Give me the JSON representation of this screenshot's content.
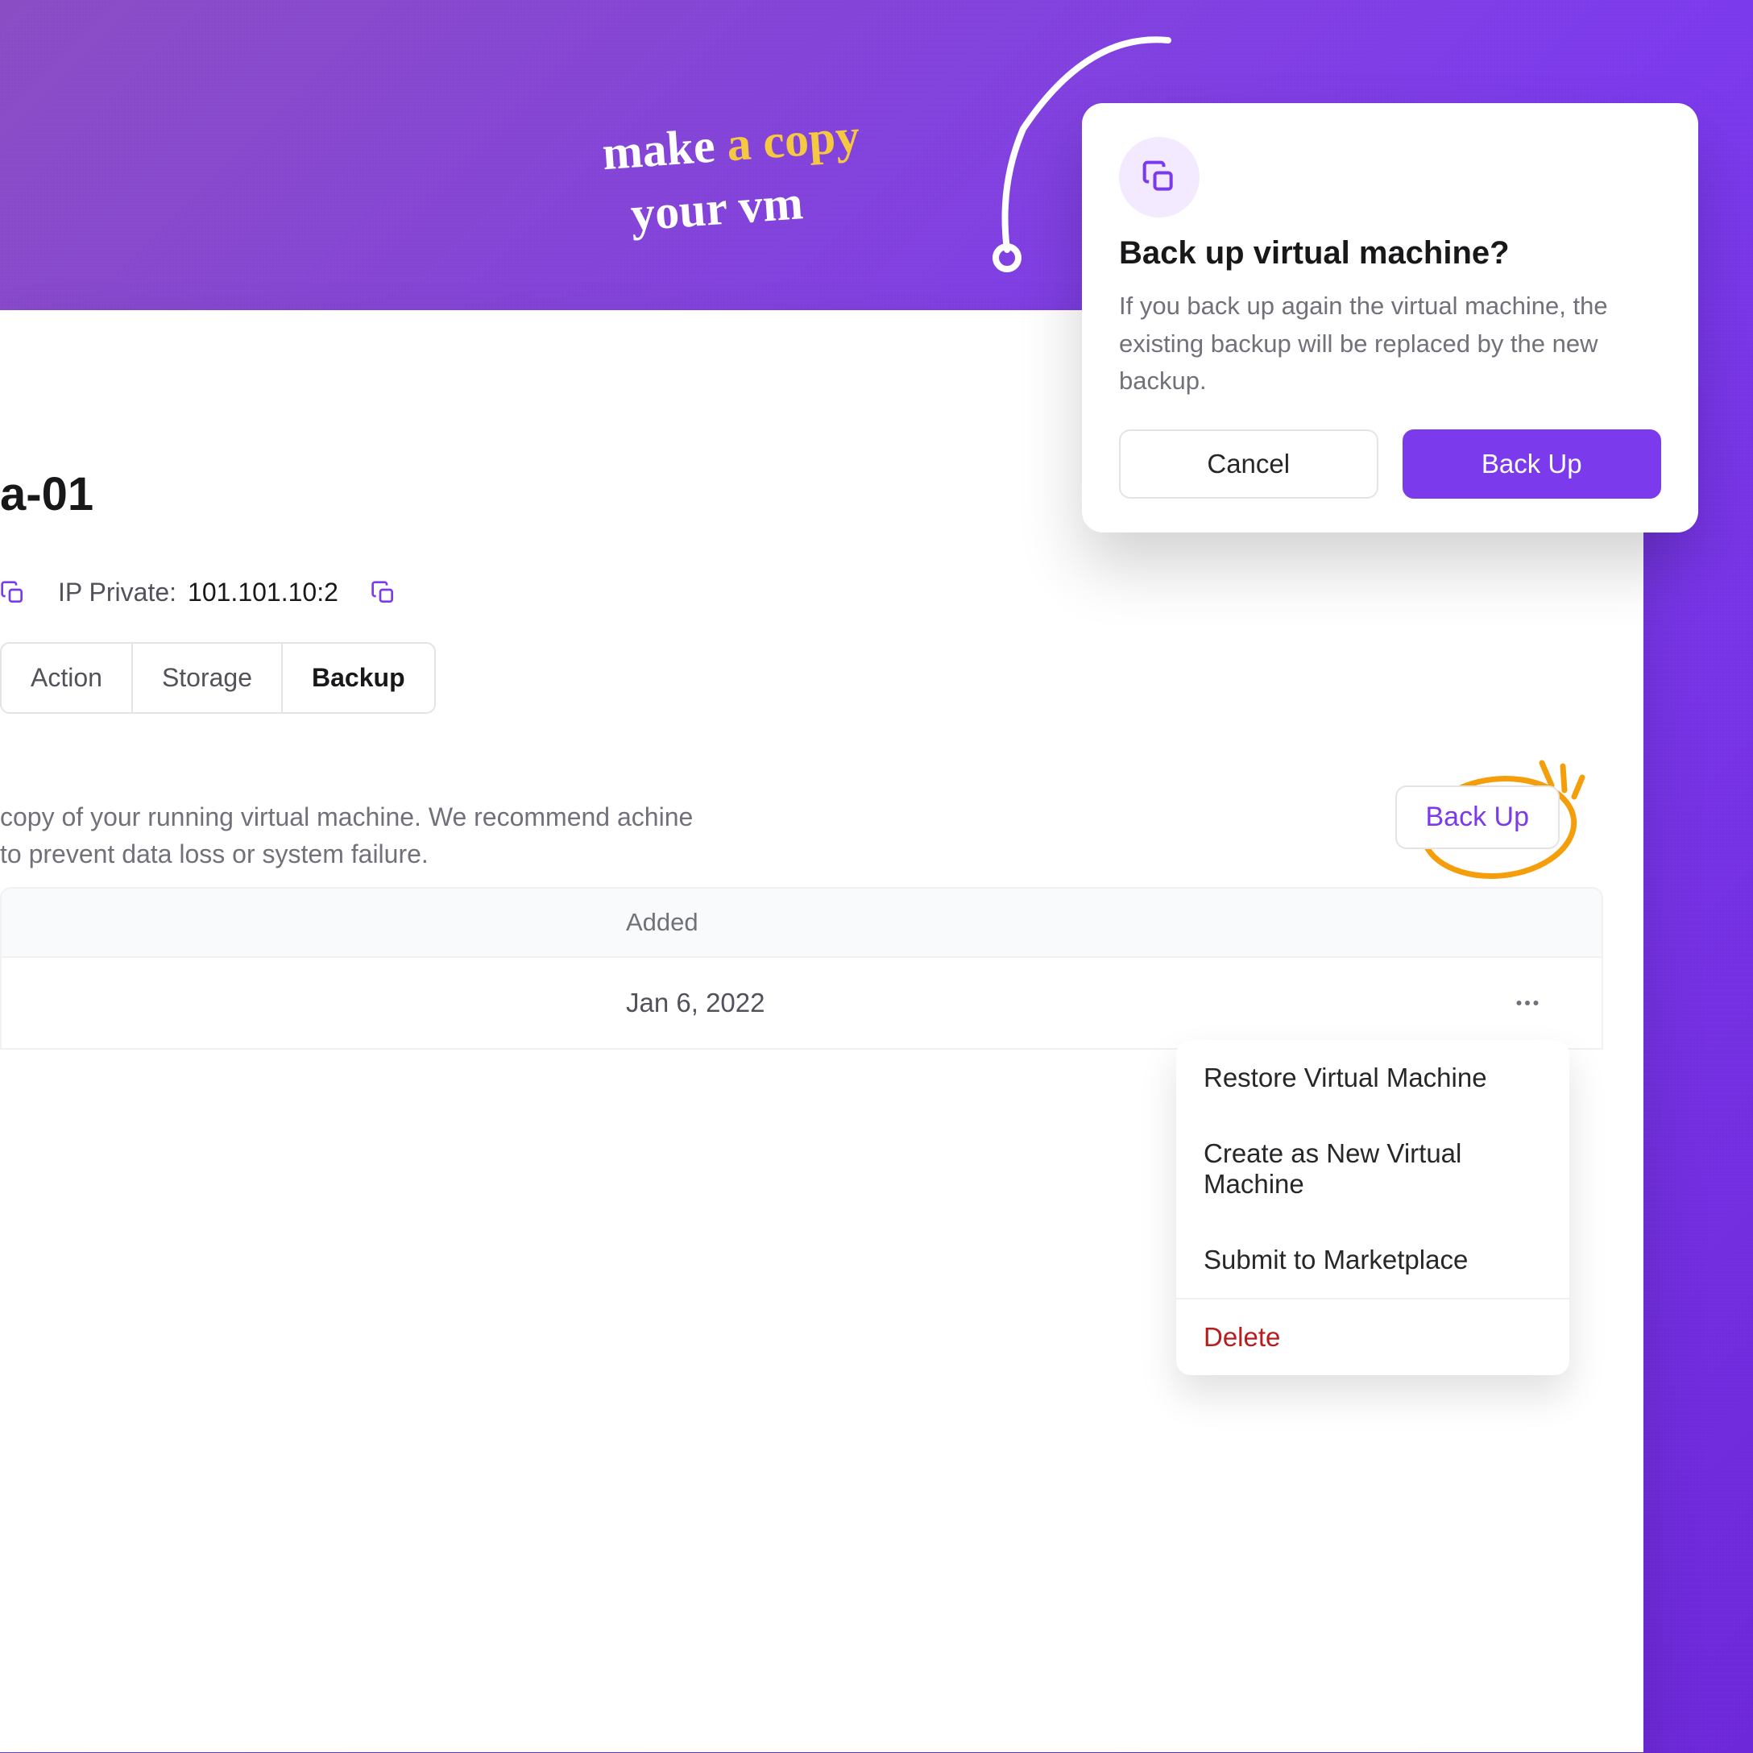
{
  "annotation": {
    "line1_a": "make",
    "line1_b": "a copy",
    "line2": "your vm"
  },
  "header": {
    "title_suffix": "a-01",
    "ip_private_label": "IP Private:",
    "ip_private_value": "101.101.10:2"
  },
  "tabs": {
    "action": "Action",
    "storage": "Storage",
    "backup": "Backup"
  },
  "description": "copy of your running virtual machine. We recommend achine to prevent data loss or system failure.",
  "backup_button": "Back Up",
  "table": {
    "header_added": "Added",
    "row1_added": "Jan 6, 2022"
  },
  "row_menu": {
    "restore": "Restore Virtual Machine",
    "create_new": "Create as New Virtual Machine",
    "submit": "Submit to Marketplace",
    "delete": "Delete"
  },
  "modal": {
    "title": "Back up virtual machine?",
    "body": "If you back up again the virtual machine, the existing backup will be replaced by the new backup.",
    "cancel": "Cancel",
    "confirm": "Back Up"
  }
}
